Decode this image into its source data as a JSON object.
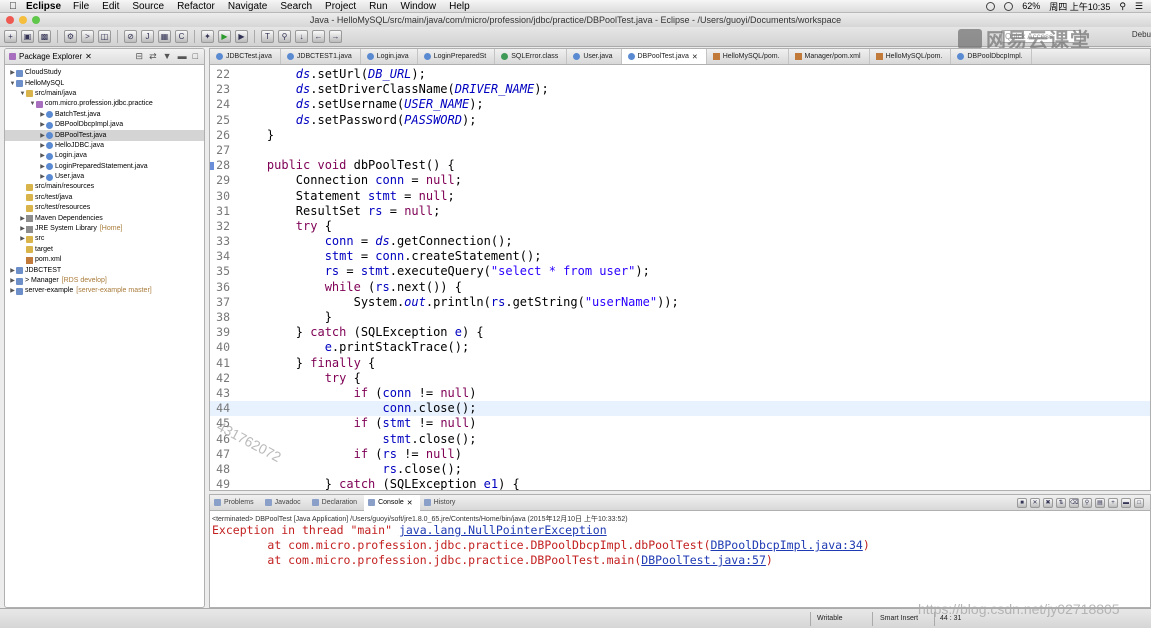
{
  "menubar": {
    "app_name": "Eclipse",
    "items": [
      "File",
      "Edit",
      "Source",
      "Refactor",
      "Navigate",
      "Search",
      "Project",
      "Run",
      "Window",
      "Help"
    ],
    "battery": "62%",
    "clock": "周四 上午10:35"
  },
  "window": {
    "title": "Java - HelloMySQL/src/main/java/com/micro/profession/jdbc/practice/DBPoolTest.java - Eclipse - /Users/guoyi/Documents/workspace"
  },
  "toolbar": {
    "quick_access_placeholder": "Quick Access",
    "debug_perspective_label": "Debu"
  },
  "brand_logo": {
    "text": "网易云课堂"
  },
  "explorer": {
    "title": "Package Explorer",
    "rows": [
      {
        "indent": 0,
        "twisty": "▶",
        "icon": "project",
        "label": "CloudStudy",
        "deco": ""
      },
      {
        "indent": 0,
        "twisty": "▼",
        "icon": "project",
        "label": "HelloMySQL",
        "deco": ""
      },
      {
        "indent": 1,
        "twisty": "▼",
        "icon": "folder",
        "label": "src/main/java",
        "deco": ""
      },
      {
        "indent": 2,
        "twisty": "▼",
        "icon": "package",
        "label": "com.micro.profession.jdbc.practice",
        "deco": ""
      },
      {
        "indent": 3,
        "twisty": "▶",
        "icon": "java",
        "label": "BatchTest.java",
        "deco": ""
      },
      {
        "indent": 3,
        "twisty": "▶",
        "icon": "java",
        "label": "DBPoolDbcpImpl.java",
        "deco": ""
      },
      {
        "indent": 3,
        "twisty": "▶",
        "icon": "java",
        "label": "DBPoolTest.java",
        "deco": "",
        "selected": true
      },
      {
        "indent": 3,
        "twisty": "▶",
        "icon": "java",
        "label": "HelloJDBC.java",
        "deco": ""
      },
      {
        "indent": 3,
        "twisty": "▶",
        "icon": "java",
        "label": "Login.java",
        "deco": ""
      },
      {
        "indent": 3,
        "twisty": "▶",
        "icon": "java",
        "label": "LoginPreparedStatement.java",
        "deco": ""
      },
      {
        "indent": 3,
        "twisty": "▶",
        "icon": "java",
        "label": "User.java",
        "deco": ""
      },
      {
        "indent": 1,
        "twisty": "",
        "icon": "folder",
        "label": "src/main/resources",
        "deco": ""
      },
      {
        "indent": 1,
        "twisty": "",
        "icon": "folder",
        "label": "src/test/java",
        "deco": ""
      },
      {
        "indent": 1,
        "twisty": "",
        "icon": "folder",
        "label": "src/test/resources",
        "deco": ""
      },
      {
        "indent": 1,
        "twisty": "▶",
        "icon": "lib",
        "label": "Maven Dependencies",
        "deco": ""
      },
      {
        "indent": 1,
        "twisty": "▶",
        "icon": "lib",
        "label": "JRE System Library",
        "deco": "[Home]"
      },
      {
        "indent": 1,
        "twisty": "▶",
        "icon": "folder",
        "label": "src",
        "deco": ""
      },
      {
        "indent": 1,
        "twisty": "",
        "icon": "folder",
        "label": "target",
        "deco": ""
      },
      {
        "indent": 1,
        "twisty": "",
        "icon": "xml",
        "label": "pom.xml",
        "deco": ""
      },
      {
        "indent": 0,
        "twisty": "▶",
        "icon": "project",
        "label": "JDBCTEST",
        "deco": ""
      },
      {
        "indent": 0,
        "twisty": "▶",
        "icon": "project",
        "label": "> Manager",
        "deco": "[RDS develop]"
      },
      {
        "indent": 0,
        "twisty": "▶",
        "icon": "project",
        "label": "server-example",
        "deco": "[server-example master]"
      }
    ]
  },
  "editor": {
    "tabs": [
      {
        "label": "JDBCTest.java",
        "kind": "java"
      },
      {
        "label": "JDBCTEST1.java",
        "kind": "java"
      },
      {
        "label": "Login.java",
        "kind": "java"
      },
      {
        "label": "LoginPreparedSt",
        "kind": "java"
      },
      {
        "label": "SQLError.class",
        "kind": "class"
      },
      {
        "label": "User.java",
        "kind": "java"
      },
      {
        "label": "DBPoolTest.java",
        "kind": "java",
        "active": true
      },
      {
        "label": "HelloMySQL/pom.",
        "kind": "xml"
      },
      {
        "label": "Manager/pom.xml",
        "kind": "xml"
      },
      {
        "label": "HelloMySQL/pom.",
        "kind": "xml"
      },
      {
        "label": "DBPoolDbcpImpl.",
        "kind": "java"
      }
    ],
    "current_line": 44,
    "lines": [
      {
        "n": "22",
        "t": [
          [
            "fld",
            "        ds"
          ],
          [
            "",
            ".setUrl("
          ],
          [
            "fld",
            "DB_URL"
          ],
          [
            "",
            ");"
          ]
        ]
      },
      {
        "n": "23",
        "t": [
          [
            "fld",
            "        ds"
          ],
          [
            "",
            ".setDriverClassName("
          ],
          [
            "fld",
            "DRIVER_NAME"
          ],
          [
            "",
            ");"
          ]
        ]
      },
      {
        "n": "24",
        "t": [
          [
            "fld",
            "        ds"
          ],
          [
            "",
            ".setUsername("
          ],
          [
            "fld",
            "USER_NAME"
          ],
          [
            "",
            ");"
          ]
        ]
      },
      {
        "n": "25",
        "t": [
          [
            "fld",
            "        ds"
          ],
          [
            "",
            ".setPassword("
          ],
          [
            "fld",
            "PASSWORD"
          ],
          [
            "",
            ");"
          ]
        ]
      },
      {
        "n": "26",
        "t": [
          [
            "",
            "    }"
          ]
        ]
      },
      {
        "n": "27",
        "t": [
          [
            "",
            ""
          ]
        ]
      },
      {
        "n": "28",
        "marker": true,
        "t": [
          [
            "kw",
            "    public void "
          ],
          [
            "",
            "dbPoolTest() {"
          ]
        ]
      },
      {
        "n": "29",
        "t": [
          [
            "",
            "        Connection "
          ],
          [
            "var",
            "conn"
          ],
          [
            "",
            " = "
          ],
          [
            "kw",
            "null"
          ],
          [
            "",
            ";"
          ]
        ]
      },
      {
        "n": "30",
        "t": [
          [
            "",
            "        Statement "
          ],
          [
            "var",
            "stmt"
          ],
          [
            "",
            " = "
          ],
          [
            "kw",
            "null"
          ],
          [
            "",
            ";"
          ]
        ]
      },
      {
        "n": "31",
        "t": [
          [
            "",
            "        ResultSet "
          ],
          [
            "var",
            "rs"
          ],
          [
            "",
            " = "
          ],
          [
            "kw",
            "null"
          ],
          [
            "",
            ";"
          ]
        ]
      },
      {
        "n": "32",
        "t": [
          [
            "kw",
            "        try"
          ],
          [
            "",
            " {"
          ]
        ]
      },
      {
        "n": "33",
        "t": [
          [
            "var",
            "            conn"
          ],
          [
            "",
            " = "
          ],
          [
            "fld",
            "ds"
          ],
          [
            "",
            ".getConnection();"
          ]
        ]
      },
      {
        "n": "34",
        "t": [
          [
            "var",
            "            stmt"
          ],
          [
            "",
            " = "
          ],
          [
            "var",
            "conn"
          ],
          [
            "",
            ".createStatement();"
          ]
        ]
      },
      {
        "n": "35",
        "t": [
          [
            "var",
            "            rs"
          ],
          [
            "",
            " = "
          ],
          [
            "var",
            "stmt"
          ],
          [
            "",
            ".executeQuery("
          ],
          [
            "str",
            "\"select * from user\""
          ],
          [
            "",
            ");"
          ]
        ]
      },
      {
        "n": "36",
        "t": [
          [
            "kw",
            "            while"
          ],
          [
            "",
            " ("
          ],
          [
            "var",
            "rs"
          ],
          [
            "",
            ".next()) {"
          ]
        ]
      },
      {
        "n": "37",
        "t": [
          [
            "",
            "                System."
          ],
          [
            "fld",
            "out"
          ],
          [
            "",
            ".println("
          ],
          [
            "var",
            "rs"
          ],
          [
            "",
            ".getString("
          ],
          [
            "str",
            "\"userName\""
          ],
          [
            "",
            "));"
          ]
        ]
      },
      {
        "n": "38",
        "t": [
          [
            "",
            "            }"
          ]
        ]
      },
      {
        "n": "39",
        "t": [
          [
            "",
            "        } "
          ],
          [
            "kw",
            "catch"
          ],
          [
            "",
            " (SQLException "
          ],
          [
            "var",
            "e"
          ],
          [
            "",
            ") {"
          ]
        ]
      },
      {
        "n": "40",
        "t": [
          [
            "var",
            "            e"
          ],
          [
            "",
            ".printStackTrace();"
          ]
        ]
      },
      {
        "n": "41",
        "t": [
          [
            "",
            "        } "
          ],
          [
            "kw",
            "finally"
          ],
          [
            "",
            " {"
          ]
        ]
      },
      {
        "n": "42",
        "t": [
          [
            "kw",
            "            try"
          ],
          [
            "",
            " {"
          ]
        ]
      },
      {
        "n": "43",
        "t": [
          [
            "kw",
            "                if"
          ],
          [
            "",
            " ("
          ],
          [
            "var",
            "conn"
          ],
          [
            "",
            " != "
          ],
          [
            "kw",
            "null"
          ],
          [
            "",
            ")"
          ]
        ]
      },
      {
        "n": "44",
        "t": [
          [
            "var",
            "                    conn"
          ],
          [
            "",
            ".close();"
          ]
        ]
      },
      {
        "n": "45",
        "t": [
          [
            "kw",
            "                if"
          ],
          [
            "",
            " ("
          ],
          [
            "var",
            "stmt"
          ],
          [
            "",
            " != "
          ],
          [
            "kw",
            "null"
          ],
          [
            "",
            ")"
          ]
        ]
      },
      {
        "n": "46",
        "t": [
          [
            "var",
            "                    stmt"
          ],
          [
            "",
            ".close();"
          ]
        ]
      },
      {
        "n": "47",
        "t": [
          [
            "kw",
            "                if"
          ],
          [
            "",
            " ("
          ],
          [
            "var",
            "rs"
          ],
          [
            "",
            " != "
          ],
          [
            "kw",
            "null"
          ],
          [
            "",
            ")"
          ]
        ]
      },
      {
        "n": "48",
        "t": [
          [
            "var",
            "                    rs"
          ],
          [
            "",
            ".close();"
          ]
        ]
      },
      {
        "n": "49",
        "t": [
          [
            "",
            "            } "
          ],
          [
            "kw",
            "catch"
          ],
          [
            "",
            " (SQLException "
          ],
          [
            "var",
            "e1"
          ],
          [
            "",
            ") {"
          ]
        ]
      }
    ],
    "watermark": "431762072"
  },
  "console": {
    "tabs": [
      {
        "label": "Problems"
      },
      {
        "label": "Javadoc"
      },
      {
        "label": "Declaration"
      },
      {
        "label": "Console",
        "active": true
      },
      {
        "label": "History"
      }
    ],
    "header": "<terminated> DBPoolTest [Java Application] /Users/guoyi/soft/jre1.8.0_65.jre/Contents/Home/bin/java (2015年12月10日 上午10:33:52)",
    "lines": [
      {
        "pre": "Exception in thread \"main\" ",
        "link": "java.lang.NullPointerException",
        "post": ""
      },
      {
        "pre": "\tat com.micro.profession.jdbc.practice.DBPoolDbcpImpl.dbPoolTest(",
        "link": "DBPoolDbcpImpl.java:34",
        "post": ")"
      },
      {
        "pre": "\tat com.micro.profession.jdbc.practice.DBPoolTest.main(",
        "link": "DBPoolTest.java:57",
        "post": ")"
      }
    ]
  },
  "statusbar": {
    "writable": "Writable",
    "insert_mode": "Smart Insert",
    "position": "44 : 31"
  },
  "url_watermark": "https://blog.csdn.net/jy02718805",
  "colors": {
    "keyword": "#7f0055",
    "field": "#0000c0",
    "string": "#2a00ff",
    "error": "#c32020",
    "link": "#1f3ab3",
    "current_line": "#e8f2fe"
  }
}
